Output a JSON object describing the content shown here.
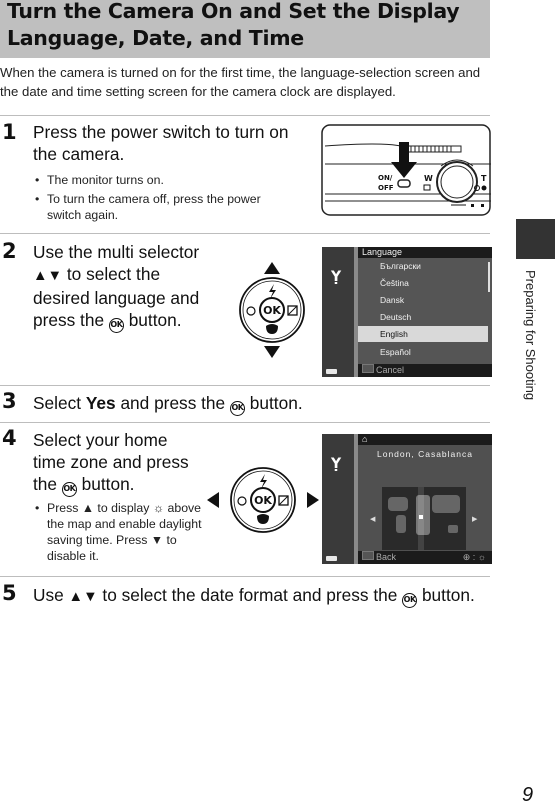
{
  "header": {
    "title_line1": "Turn the Camera On and Set the Display",
    "title_line2": "Language, Date, and Time"
  },
  "intro": "When the camera is turned on for the first time, the language-selection screen and the date and time setting screen for the camera clock are displayed.",
  "steps": [
    {
      "number": "1",
      "text_line1": "Press the power switch to turn on",
      "text_line2": "the camera.",
      "bullets": [
        "The monitor turns on.",
        "To turn the camera off, press the power switch again."
      ],
      "illustration": {
        "power_label_top": "ON/",
        "power_label_bottom": "OFF",
        "wide_label": "W",
        "tele_label": "T"
      }
    },
    {
      "number": "2",
      "text_a": "Use the multi selector",
      "text_b": "▲▼",
      "text_c": " to select the",
      "text_d": "desired language and",
      "text_e": "press the ",
      "text_f": " button.",
      "ok_label": "OK",
      "screen": {
        "title": "Language",
        "items": [
          "Български",
          "Čeština",
          "Dansk",
          "Deutsch",
          "English",
          "Español"
        ],
        "selected": "English",
        "footer": "Cancel"
      }
    },
    {
      "number": "3",
      "text_a": "Select ",
      "text_bold": "Yes",
      "text_b": " and press the ",
      "text_c": " button.",
      "ok_label": "OK"
    },
    {
      "number": "4",
      "text_line1": "Select your home",
      "text_line2": "time zone and press",
      "text_line3a": "the ",
      "text_line3b": " button.",
      "ok_label": "OK",
      "bullet_a": "Press ▲ to display ",
      "bullet_icon": "dst-icon",
      "bullet_b": " above the map and enable daylight saving time. Press ▼ to disable it.",
      "screen": {
        "location": "London, Casablanca",
        "footer": "Back",
        "footer_right": "⊕ : "
      }
    },
    {
      "number": "5",
      "text_a": "Use ",
      "text_arrows": "▲▼",
      "text_b": " to select the date format and press the ",
      "text_c": " button.",
      "ok_label": "OK"
    }
  ],
  "multi_selector": {
    "center_label": "OK",
    "up_icon": "flash-icon",
    "down_icon": "macro-icon",
    "left_icon": "self-timer-icon",
    "right_icon": "exposure-compensation-icon"
  },
  "side_tab": {
    "label": "Preparing for Shooting"
  },
  "page_number": "9"
}
